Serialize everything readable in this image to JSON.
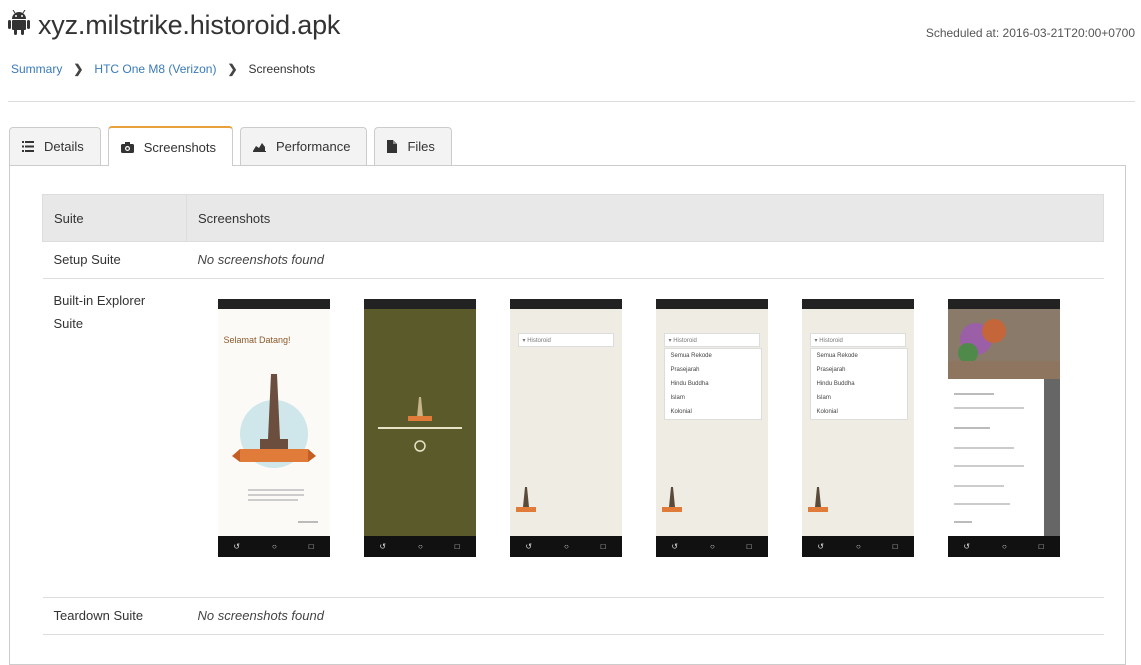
{
  "app": {
    "title": "xyz.milstrike.historoid.apk",
    "scheduled": "Scheduled at: 2016-03-21T20:00+0700"
  },
  "breadcrumb": {
    "summary": "Summary",
    "device": "HTC One M8 (Verizon)",
    "current": "Screenshots"
  },
  "tabs": [
    {
      "label": "Details",
      "icon": "list-icon"
    },
    {
      "label": "Screenshots",
      "icon": "camera-icon",
      "active": true
    },
    {
      "label": "Performance",
      "icon": "chart-icon"
    },
    {
      "label": "Files",
      "icon": "file-icon"
    }
  ],
  "table": {
    "headers": [
      "Suite",
      "Screenshots"
    ],
    "rows": [
      {
        "suite": "Setup Suite",
        "screenshots": "No screenshots found"
      },
      {
        "suite": "Built-in Explorer Suite",
        "screenshots": ""
      },
      {
        "suite": "Teardown Suite",
        "screenshots": "No screenshots found"
      }
    ]
  },
  "thumbs": {
    "welcome": "Selamat Datang!",
    "search": "Historoid",
    "menu": [
      "Semua Rekode",
      "Prasejarah",
      "Hindu Buddha",
      "Islam",
      "Kolonial"
    ]
  },
  "colors": {
    "accent": "#e8a13d",
    "link": "#3a7ab8",
    "olive": "#5a5a2a"
  }
}
